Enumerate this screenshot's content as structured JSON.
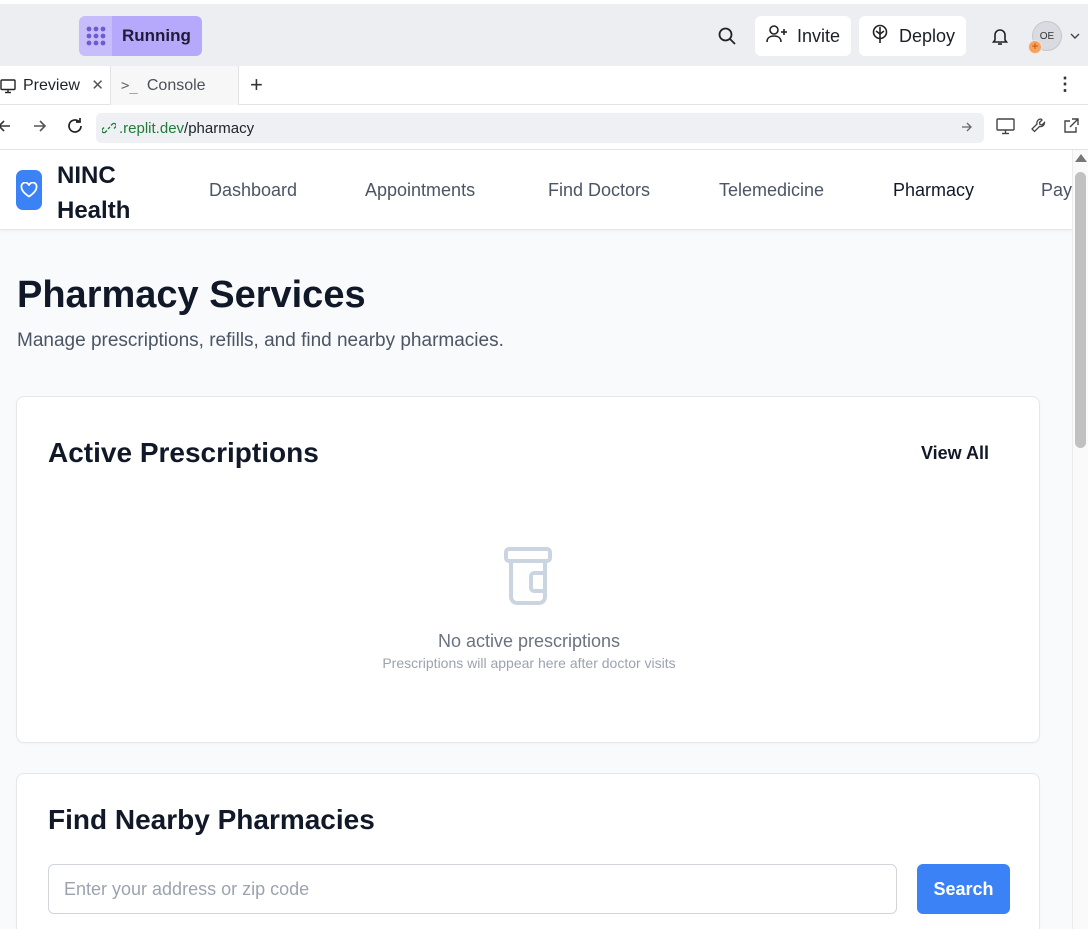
{
  "replit": {
    "run_label": "Running",
    "invite_label": "Invite",
    "deploy_label": "Deploy",
    "avatar_initials": "OE"
  },
  "tabs": [
    {
      "label": "Preview",
      "icon": "monitor-icon"
    },
    {
      "label": "Console",
      "icon": "terminal-icon"
    }
  ],
  "address": {
    "domain": ".replit.dev",
    "path": "/pharmacy"
  },
  "app": {
    "brand_line1": "NINC",
    "brand_line2": "Health",
    "nav": [
      {
        "label": "Dashboard"
      },
      {
        "label": "Appointments"
      },
      {
        "label": "Find Doctors"
      },
      {
        "label": "Telemedicine"
      },
      {
        "label": "Pharmacy"
      },
      {
        "label": "Payments"
      }
    ],
    "page_title": "Pharmacy Services",
    "page_subtitle": "Manage prescriptions, refills, and find nearby pharmacies.",
    "prescriptions": {
      "title": "Active Prescriptions",
      "view_all": "View All",
      "empty_title": "No active prescriptions",
      "empty_sub": "Prescriptions will appear here after doctor visits"
    },
    "pharmacies": {
      "title": "Find Nearby Pharmacies",
      "search_placeholder": "Enter your address or zip code",
      "search_value": "",
      "search_button": "Search"
    }
  },
  "colors": {
    "accent": "#3b82f6",
    "run_purple": "#b6a9fb",
    "url_green": "#1e7d3a"
  }
}
